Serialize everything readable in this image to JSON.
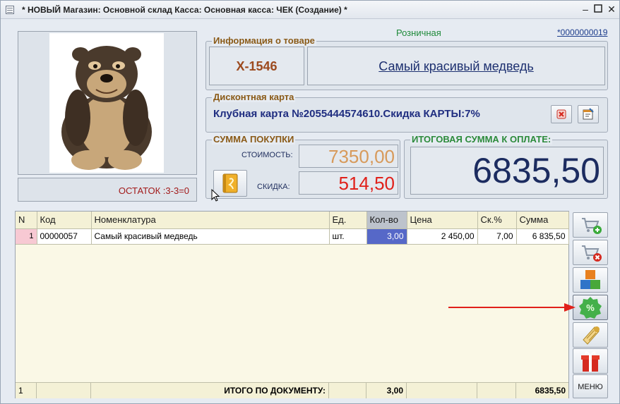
{
  "window": {
    "title": "* НОВЫЙ Магазин: Основной склад Касса: Основная касса: ЧЕК (Создание) *"
  },
  "header": {
    "price_type": "Розничная",
    "doc_number": "*0000000019"
  },
  "stock": {
    "label": "ОСТАТОК :3-3=0"
  },
  "product_info": {
    "legend": "Информация о товаре",
    "article": "Х-1546",
    "name": "Самый красивый медведь"
  },
  "discount_card": {
    "legend": "Дисконтная карта",
    "text": "Клубная карта №2055444574610.Скидка КАРТЫ:7%"
  },
  "purchase_sum": {
    "legend": "СУММА ПОКУПКИ",
    "cost_label": "СТОИМОСТЬ:",
    "cost_value": "7350,00",
    "discount_label": "СКИДКА:",
    "discount_value": "514,50"
  },
  "total_to_pay": {
    "legend": "ИТОГОВАЯ СУММА К ОПЛАТЕ:",
    "value": "6835,50"
  },
  "table": {
    "headers": [
      "N",
      "Код",
      "Номенклатура",
      "Ед.",
      "Кол-во",
      "Цена",
      "Ск.%",
      "Сумма"
    ],
    "rows": [
      [
        "1",
        "00000057",
        "Самый красивый медведь",
        "шт.",
        "3,00",
        "2 450,00",
        "7,00",
        "6 835,50"
      ]
    ],
    "footer": {
      "row_count": "1",
      "total_label": "ИТОГО ПО ДОКУМЕНТУ:",
      "total_qty": "3,00",
      "total_sum": "6835,50"
    }
  },
  "sidebar": {
    "menu_label": "МЕНЮ"
  },
  "colors": {
    "accent_blue": "#1f2d80",
    "brown": "#9c4a1e",
    "discount_red": "#e0201a",
    "cost_orange": "#d79a5b",
    "total_navy": "#1c2c60"
  }
}
